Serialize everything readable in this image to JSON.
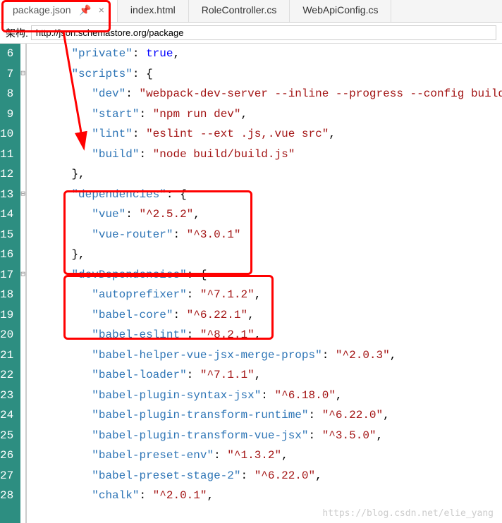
{
  "tabs": [
    {
      "label": "package.json",
      "active": true,
      "pinned": true
    },
    {
      "label": "index.html",
      "active": false
    },
    {
      "label": "RoleController.cs",
      "active": false
    },
    {
      "label": "WebApiConfig.cs",
      "active": false
    }
  ],
  "schema": {
    "label": "架构:",
    "url": "http://json.schemastore.org/package"
  },
  "code": {
    "lines": [
      {
        "num": 6,
        "indent": 2,
        "fold": "",
        "key": "private",
        "val": "true",
        "valType": "bool",
        "trail": ","
      },
      {
        "num": 7,
        "indent": 2,
        "fold": "⊟",
        "key": "scripts",
        "val": "{",
        "valType": "brace",
        "trail": ""
      },
      {
        "num": 8,
        "indent": 3,
        "fold": "",
        "key": "dev",
        "val": "webpack-dev-server --inline --progress --config build/",
        "valType": "str",
        "trail": ""
      },
      {
        "num": 9,
        "indent": 3,
        "fold": "",
        "key": "start",
        "val": "npm run dev",
        "valType": "str",
        "trail": ","
      },
      {
        "num": 10,
        "indent": 3,
        "fold": "",
        "key": "lint",
        "val": "eslint --ext .js,.vue src",
        "valType": "str",
        "trail": ","
      },
      {
        "num": 11,
        "indent": 3,
        "fold": "",
        "key": "build",
        "val": "node build/build.js",
        "valType": "str",
        "trail": ""
      },
      {
        "num": 12,
        "indent": 2,
        "fold": "",
        "key": "",
        "val": "},",
        "valType": "close",
        "trail": ""
      },
      {
        "num": 13,
        "indent": 2,
        "fold": "⊟",
        "key": "dependencies",
        "val": "{",
        "valType": "brace",
        "trail": ""
      },
      {
        "num": 14,
        "indent": 3,
        "fold": "",
        "key": "vue",
        "val": "^2.5.2",
        "valType": "str",
        "trail": ","
      },
      {
        "num": 15,
        "indent": 3,
        "fold": "",
        "key": "vue-router",
        "val": "^3.0.1",
        "valType": "str",
        "trail": ""
      },
      {
        "num": 16,
        "indent": 2,
        "fold": "",
        "key": "",
        "val": "},",
        "valType": "close",
        "trail": ""
      },
      {
        "num": 17,
        "indent": 2,
        "fold": "⊟",
        "key": "devDependencies",
        "val": "{",
        "valType": "brace",
        "trail": ""
      },
      {
        "num": 18,
        "indent": 3,
        "fold": "",
        "key": "autoprefixer",
        "val": "^7.1.2",
        "valType": "str",
        "trail": ","
      },
      {
        "num": 19,
        "indent": 3,
        "fold": "",
        "key": "babel-core",
        "val": "^6.22.1",
        "valType": "str",
        "trail": ","
      },
      {
        "num": 20,
        "indent": 3,
        "fold": "",
        "key": "babel-eslint",
        "val": "^8.2.1",
        "valType": "str",
        "trail": ","
      },
      {
        "num": 21,
        "indent": 3,
        "fold": "",
        "key": "babel-helper-vue-jsx-merge-props",
        "val": "^2.0.3",
        "valType": "str",
        "trail": ","
      },
      {
        "num": 22,
        "indent": 3,
        "fold": "",
        "key": "babel-loader",
        "val": "^7.1.1",
        "valType": "str",
        "trail": ","
      },
      {
        "num": 23,
        "indent": 3,
        "fold": "",
        "key": "babel-plugin-syntax-jsx",
        "val": "^6.18.0",
        "valType": "str",
        "trail": ","
      },
      {
        "num": 24,
        "indent": 3,
        "fold": "",
        "key": "babel-plugin-transform-runtime",
        "val": "^6.22.0",
        "valType": "str",
        "trail": ","
      },
      {
        "num": 25,
        "indent": 3,
        "fold": "",
        "key": "babel-plugin-transform-vue-jsx",
        "val": "^3.5.0",
        "valType": "str",
        "trail": ","
      },
      {
        "num": 26,
        "indent": 3,
        "fold": "",
        "key": "babel-preset-env",
        "val": "^1.3.2",
        "valType": "str",
        "trail": ","
      },
      {
        "num": 27,
        "indent": 3,
        "fold": "",
        "key": "babel-preset-stage-2",
        "val": "^6.22.0",
        "valType": "str",
        "trail": ","
      },
      {
        "num": 28,
        "indent": 3,
        "fold": "",
        "key": "chalk",
        "val": "^2.0.1",
        "valType": "str",
        "trail": ","
      }
    ]
  },
  "watermark": "https://blog.csdn.net/elie_yang"
}
